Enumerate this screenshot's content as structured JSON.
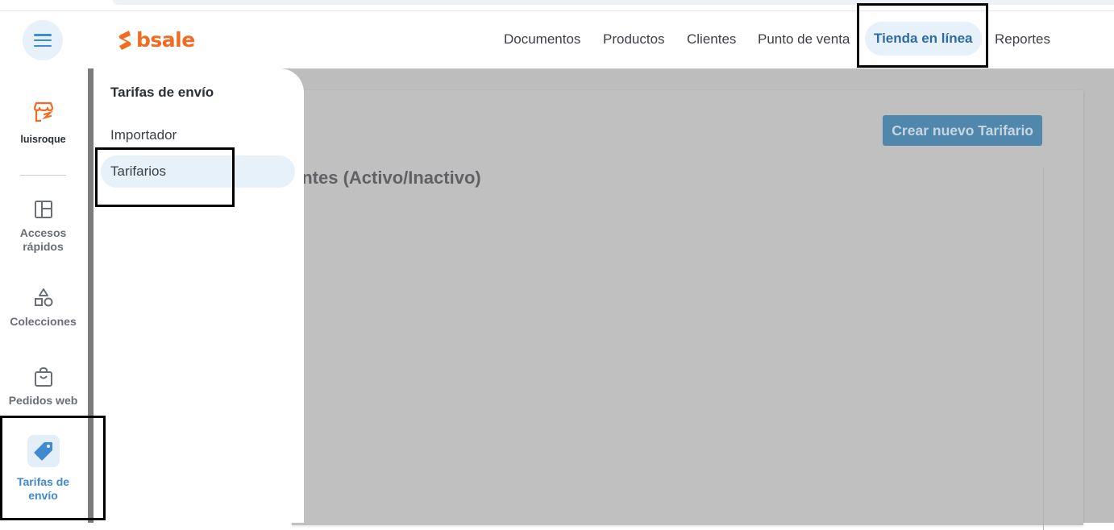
{
  "header": {
    "brand": "bsale",
    "nav": [
      {
        "label": "Documentos",
        "active": false
      },
      {
        "label": "Productos",
        "active": false
      },
      {
        "label": "Clientes",
        "active": false
      },
      {
        "label": "Punto de venta",
        "active": false
      },
      {
        "label": "Tienda en línea",
        "active": true
      },
      {
        "label": "Reportes",
        "active": false
      }
    ]
  },
  "sidebar": {
    "store_name": "luisroque",
    "items": [
      {
        "label": "Accesos rápidos",
        "icon": "layout-icon",
        "active": false
      },
      {
        "label": "Colecciones",
        "icon": "shapes-icon",
        "active": false
      },
      {
        "label": "Pedidos web",
        "icon": "shopping-bag-icon",
        "active": false
      },
      {
        "label": "Tarifas de envío",
        "icon": "tag-icon",
        "active": true
      }
    ]
  },
  "flyout": {
    "title": "Tarifas de envío",
    "items": [
      {
        "label": "Importador",
        "active": false
      },
      {
        "label": "Tarifarios",
        "active": true
      }
    ]
  },
  "main": {
    "create_button": "Crear nuevo Tarifario",
    "section_title_visible": "entes (Activo/Inactivo)"
  },
  "colors": {
    "brand_orange": "#f26b21",
    "accent_blue": "#3f8ad0",
    "active_pill": "#e6f1fa",
    "overlay_gray": "#bdbdbd"
  }
}
